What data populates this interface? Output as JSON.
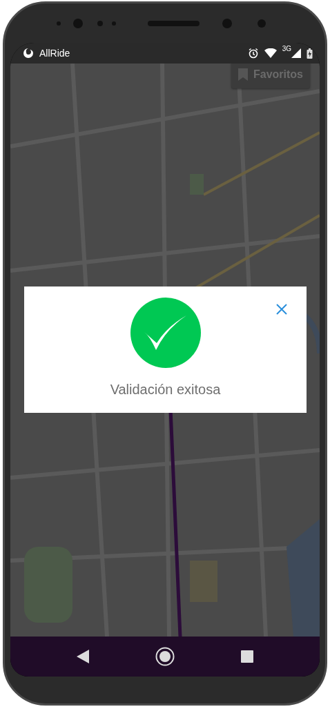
{
  "status_bar": {
    "app_name": "AllRide",
    "network": "3G"
  },
  "favorites_button": {
    "label": "Favoritos"
  },
  "dialog": {
    "message": "Validación exitosa"
  }
}
